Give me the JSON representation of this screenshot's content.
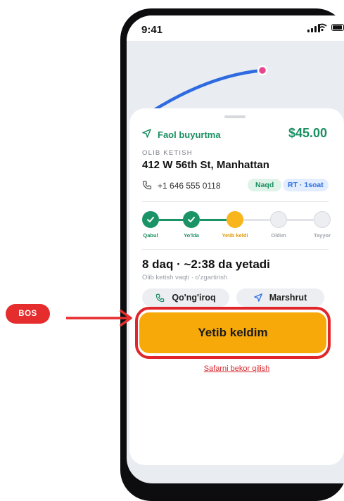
{
  "status_bar": {
    "time": "9:41"
  },
  "colors": {
    "accent_green": "#1a8f62",
    "accent_yellow": "#f7a90a",
    "highlight_red": "#e0262b",
    "route_blue": "#2f6be0"
  },
  "order": {
    "status_label": "Faol buyurtma",
    "fare": "$45.00",
    "pickup_caption": "OLIB KETISH",
    "address": "412 W 56th St, Manhattan",
    "phone": "+1 646 555 0118",
    "payment_badge": "Naqd",
    "rate_badge": "RT · 1soat"
  },
  "steps": [
    {
      "label": "Qabul",
      "state": "done"
    },
    {
      "label": "Yo'lda",
      "state": "done"
    },
    {
      "label": "Yetib keldi",
      "state": "active"
    },
    {
      "label": "Oldim",
      "state": "todo"
    },
    {
      "label": "Tayyor",
      "state": "todo"
    }
  ],
  "eta": {
    "title": "8 daq · ~2:38 da yetadi",
    "subtitle": "Olib ketish vaqti · o'zgartirish"
  },
  "actions": {
    "call_label": "Qo'ng'iroq",
    "route_label": "Marshrut",
    "primary_label": "Yetib keldim",
    "cancel_label": "Safarni bekor qilish"
  },
  "annotation": {
    "tag": "BOS"
  }
}
